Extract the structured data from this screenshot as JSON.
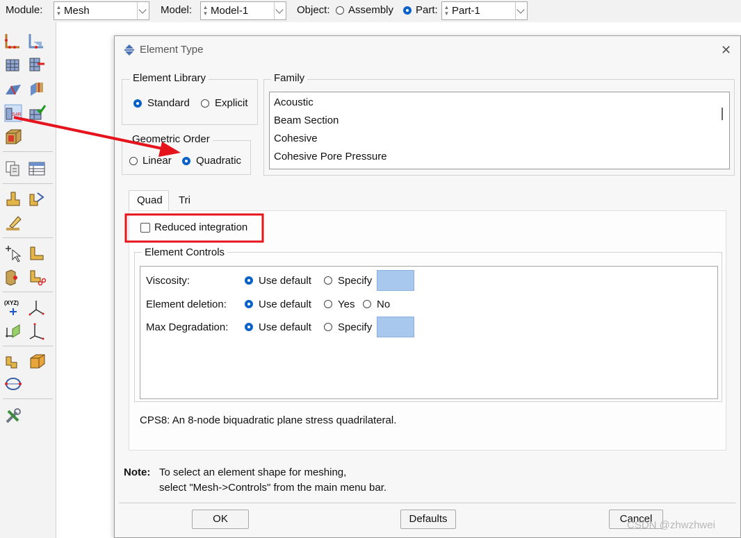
{
  "topbar": {
    "module_label": "Module:",
    "module_value": "Mesh",
    "model_label": "Model:",
    "model_value": "Model-1",
    "object_label": "Object:",
    "assembly_label": "Assembly",
    "part_label": "Part:",
    "part_value": "Part-1",
    "object_selected": "Part"
  },
  "dialog": {
    "title": "Element Type",
    "close_icon": "close-icon",
    "element_library": {
      "label": "Element Library",
      "options": [
        "Standard",
        "Explicit"
      ],
      "selected": "Standard"
    },
    "geometric_order": {
      "label": "Geometric Order",
      "options": [
        "Linear",
        "Quadratic"
      ],
      "selected": "Quadratic"
    },
    "family": {
      "label": "Family",
      "items": [
        "Acoustic",
        "Beam Section",
        "Cohesive",
        "Cohesive Pore Pressure"
      ]
    },
    "tabs": [
      {
        "label": "Quad",
        "active": true
      },
      {
        "label": "Tri",
        "active": false
      }
    ],
    "reduced_integration": {
      "label": "Reduced integration",
      "checked": false
    },
    "element_controls": {
      "label": "Element Controls",
      "viscosity": {
        "label": "Viscosity:",
        "use_default": "Use default",
        "specify": "Specify"
      },
      "element_deletion": {
        "label": "Element deletion:",
        "use_default": "Use default",
        "yes": "Yes",
        "no": "No"
      },
      "max_degradation": {
        "label": "Max Degradation:",
        "use_default": "Use default",
        "specify": "Specify"
      }
    },
    "description": "CPS8:  An 8-node biquadratic plane stress quadrilateral.",
    "note_label": "Note:",
    "note_line1": "To select an element shape for meshing,",
    "note_line2": "select \"Mesh->Controls\" from the main menu bar.",
    "buttons": {
      "ok": "OK",
      "defaults": "Defaults",
      "cancel": "Cancel"
    }
  },
  "watermark": "CSDN @zhwzhwei",
  "colors": {
    "accent": "#0a62c9",
    "annotation": "#e5141c",
    "swatch": "#a9c8ee"
  }
}
